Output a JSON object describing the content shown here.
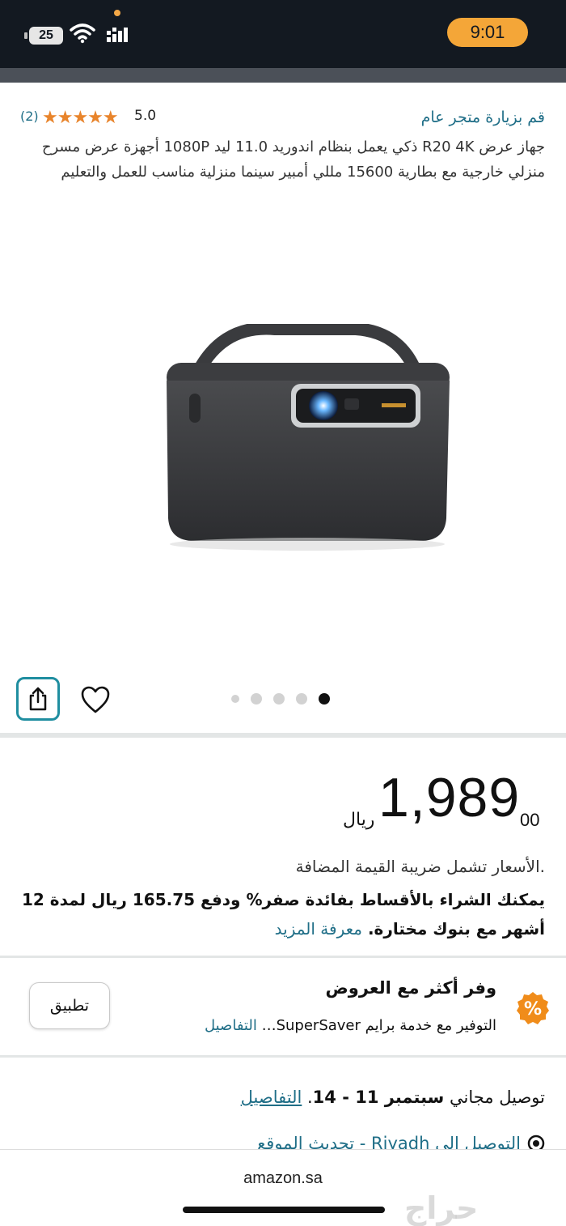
{
  "status_bar": {
    "battery": "25",
    "time": "9:01"
  },
  "product": {
    "store_link": "قم بزيارة متجر عام",
    "rating_value": "5.0",
    "stars": "★★★★★",
    "rating_count": "(2)",
    "title": "جهاز عرض R20 4K ذكي يعمل بنظام اندوريد 11.0 ليد 1080P أجهزة عرض مسرح منزلي خارجية مع بطارية 15600 مللي أمبير سينما منزلية مناسب للعمل والتعليم",
    "image_alt": "portable projector"
  },
  "gallery": {
    "dots_count": 5,
    "active_index": 4
  },
  "price": {
    "main": "1,989",
    "cents": "00",
    "currency": "ريال",
    "vat_note": ".الأسعار تشمل ضريبة القيمة المضافة",
    "installment_text": "يمكنك الشراء بالأقساط بفائدة صفر% ودفع 165.75 ريال لمدة 12 أشهر مع بنوك مختارة.",
    "learn_more": "معرفة المزيد"
  },
  "offers": {
    "title": "وفر أكثر مع العروض",
    "subtitle": "التوفير مع خدمة برايم SuperSaver…",
    "details_link": "التفاصيل",
    "apply_button": "تطبيق"
  },
  "delivery": {
    "prefix": "توصيل مجاني",
    "dates": "سبتمبر 11 - 14",
    "details_link": "التفاصيل",
    "location": "التوصيل الى Riyadh - تحديث الموقع"
  },
  "browser": {
    "url": "amazon.sa"
  },
  "watermark": "حراج",
  "colors": {
    "header_bg": "#131921",
    "time_pill": "#f4a638",
    "link": "#1f6e87",
    "star": "#e8842b",
    "offer_badge": "#f08c1a"
  }
}
